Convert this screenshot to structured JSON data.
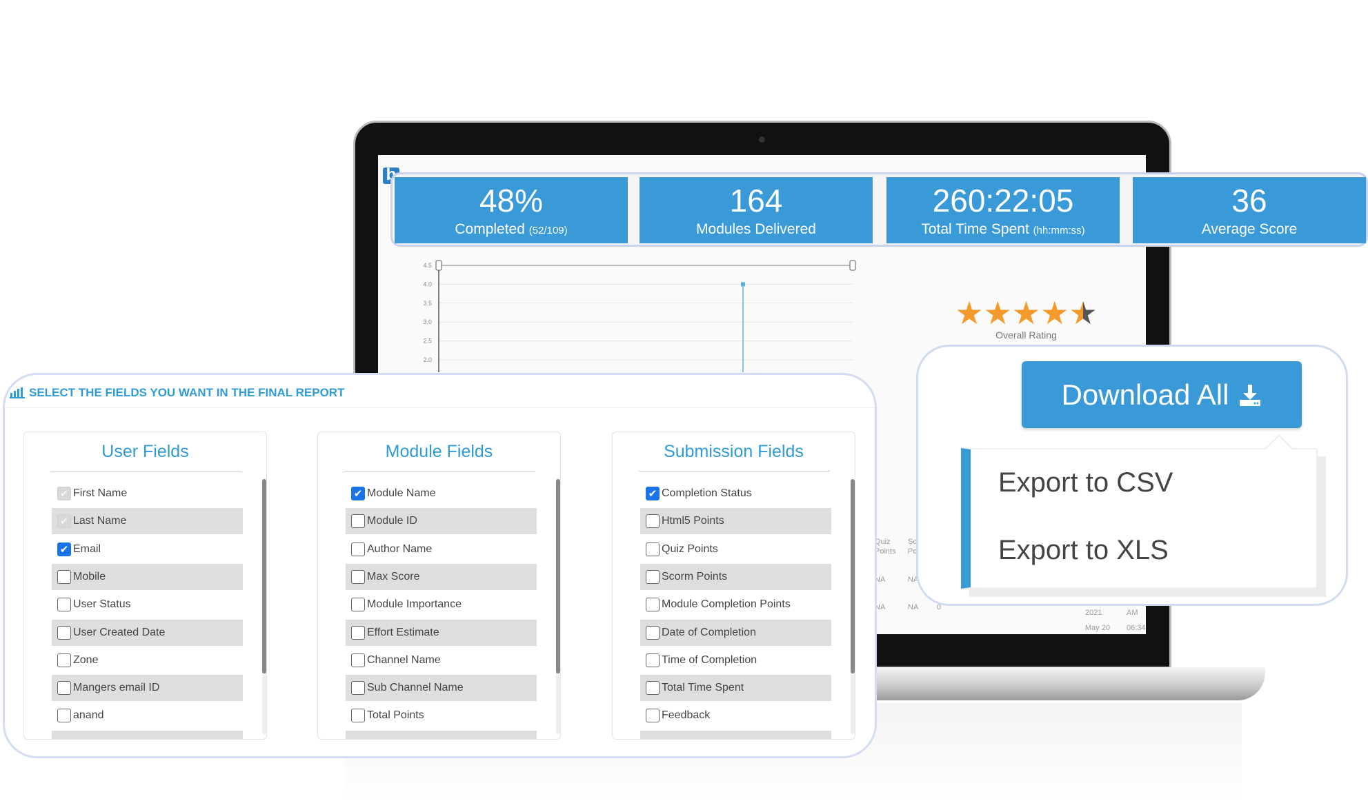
{
  "app": {
    "logo": "b"
  },
  "stats": [
    {
      "value": "48%",
      "label": "Completed",
      "sub": "(52/109)"
    },
    {
      "value": "164",
      "label": "Modules Delivered",
      "sub": ""
    },
    {
      "value": "260:22:05",
      "label": "Total Time Spent",
      "sub": "(hh:mm:ss)"
    },
    {
      "value": "36",
      "label": "Average Score",
      "sub": ""
    }
  ],
  "chart_data": {
    "type": "line",
    "y_ticks": [
      "4.5",
      "4.0",
      "3.5",
      "3.0",
      "2.5",
      "2.0"
    ],
    "ylim": [
      2.0,
      4.5
    ],
    "grid": true,
    "points": [
      {
        "y": 4.0
      }
    ],
    "color": "#5ab4e0"
  },
  "rating": {
    "value": 4.5,
    "max": 5,
    "label": "Overall Rating",
    "star_color": "#f39a2b"
  },
  "table": {
    "h1": "Quiz",
    "h2": "Points",
    "h3": "Sc",
    "h4": "Po",
    "c1": "NA",
    "c2": "NA",
    "c3": "NA",
    "c4": "NA",
    "c5": "0",
    "d1": "2021",
    "d2": "AM",
    "d3": "May 20",
    "d4": "06:34"
  },
  "download": {
    "label": "Download All",
    "icon": "download-icon",
    "menu": [
      "Export to CSV",
      "Export to XLS"
    ]
  },
  "panel": {
    "title": "SELECT THE FIELDS YOU WANT IN THE FINAL REPORT",
    "icon": "bar-chart-icon",
    "columns": [
      {
        "title": "User Fields",
        "items": [
          {
            "label": "First Name",
            "state": "disabled-checked"
          },
          {
            "label": "Last Name",
            "state": "disabled-checked"
          },
          {
            "label": "Email",
            "state": "checked"
          },
          {
            "label": "Mobile",
            "state": "unchecked"
          },
          {
            "label": "User Status",
            "state": "unchecked"
          },
          {
            "label": "User Created Date",
            "state": "unchecked"
          },
          {
            "label": "Zone",
            "state": "unchecked"
          },
          {
            "label": "Mangers email ID",
            "state": "unchecked"
          },
          {
            "label": "anand",
            "state": "unchecked"
          }
        ]
      },
      {
        "title": "Module Fields",
        "items": [
          {
            "label": "Module Name",
            "state": "checked"
          },
          {
            "label": "Module ID",
            "state": "unchecked"
          },
          {
            "label": "Author Name",
            "state": "unchecked"
          },
          {
            "label": "Max Score",
            "state": "unchecked"
          },
          {
            "label": "Module Importance",
            "state": "unchecked"
          },
          {
            "label": "Effort Estimate",
            "state": "unchecked"
          },
          {
            "label": "Channel Name",
            "state": "unchecked"
          },
          {
            "label": "Sub Channel Name",
            "state": "unchecked"
          },
          {
            "label": "Total Points",
            "state": "unchecked"
          }
        ]
      },
      {
        "title": "Submission Fields",
        "items": [
          {
            "label": "Completion Status",
            "state": "checked"
          },
          {
            "label": "Html5 Points",
            "state": "unchecked"
          },
          {
            "label": "Quiz Points",
            "state": "unchecked"
          },
          {
            "label": "Scorm Points",
            "state": "unchecked"
          },
          {
            "label": "Module Completion Points",
            "state": "unchecked"
          },
          {
            "label": "Date of Completion",
            "state": "unchecked"
          },
          {
            "label": "Time of Completion",
            "state": "unchecked"
          },
          {
            "label": "Total Time Spent",
            "state": "unchecked"
          },
          {
            "label": "Feedback",
            "state": "unchecked"
          }
        ]
      }
    ]
  }
}
